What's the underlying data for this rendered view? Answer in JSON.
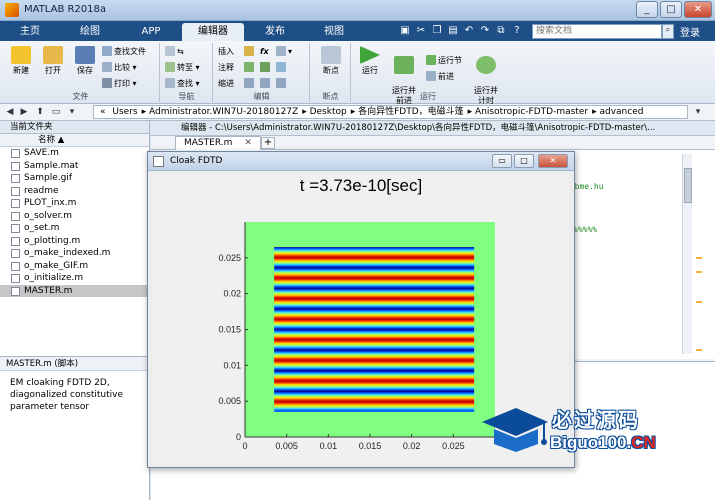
{
  "window": {
    "title": "MATLAB R2018a"
  },
  "tabs": [
    "主页",
    "绘图",
    "APP",
    "编辑器",
    "发布",
    "视图"
  ],
  "search": {
    "placeholder": "搜索文档"
  },
  "login": "登录",
  "ribbon": {
    "file": {
      "new": "新建",
      "open": "打开",
      "save": "保存",
      "find_files": "查找文件",
      "compare": "比较",
      "print": "打印",
      "label": "文件"
    },
    "navigate": {
      "goto": "转至",
      "find": "查找",
      "label": "导航"
    },
    "edit": {
      "insert": "插入",
      "comment": "注释",
      "indent": "缩进",
      "fx": "fx",
      "label": "编辑"
    },
    "breakpoints": {
      "breakpoints": "断点",
      "label": "断点"
    },
    "run": {
      "run": "运行",
      "run_advance": "运行并\n前进",
      "run_section": "运行节",
      "advance": "前进",
      "run_time": "运行并\n计时",
      "label": "运行"
    }
  },
  "address": {
    "prefix": "«",
    "segments": [
      "Users",
      "Administrator.WIN7U-20180127Z",
      "Desktop",
      "各向异性FDTD，电磁斗篷",
      "Anisotropic-FDTD-master",
      "advanced"
    ]
  },
  "filebrowser": {
    "header": "当前文件夹",
    "column": "名称 ▲",
    "files": [
      "SAVE.m",
      "Sample.mat",
      "Sample.gif",
      "readme",
      "PLOT_inx.m",
      "o_solver.m",
      "o_set.m",
      "o_plotting.m",
      "o_make_indexed.m",
      "o_make_GIF.m",
      "o_initialize.m",
      "MASTER.m"
    ],
    "selected": "MASTER.m"
  },
  "details": {
    "header": "MASTER.m  (脚本)",
    "description": "EM cloaking FDTD 2D, diagonalized constitutive parameter tensor"
  },
  "editor": {
    "header": "编辑器 - C:\\Users\\Administrator.WIN7U-20180127Z\\Desktop\\各向异性FDTD，电磁斗篷\\Anisotropic-FDTD-master\\...",
    "tab": "MASTER.m",
    "plus": "+",
    "fragment1": "h.bme.hu",
    "fragment2": "%%%%%"
  },
  "figure": {
    "window_title": "Cloak FDTD",
    "plot_title": "t =3.73e-10[sec]"
  },
  "chart_data": {
    "type": "heatmap",
    "title": "t =3.73e-10[sec]",
    "xlabel": "",
    "ylabel": "",
    "xlim": [
      0,
      0.03
    ],
    "ylim": [
      0,
      0.03
    ],
    "xticks": [
      0,
      0.005,
      0.01,
      0.015,
      0.02,
      0.025
    ],
    "yticks": [
      0,
      0.005,
      0.01,
      0.015,
      0.02,
      0.025
    ],
    "background_color": "#80ff80",
    "field_region": {
      "x": [
        0.0035,
        0.0275
      ],
      "y": [
        0.0035,
        0.0265
      ]
    },
    "pattern": "horizontal plane wave bands alternating red and blue",
    "band_count": 8
  },
  "watermark": {
    "title": "必过源码",
    "sub_prefix": "Biguo100.",
    "sub_suffix": "CN"
  },
  "colors": {
    "tab_bar": "#1e4f86",
    "accent": "#0b4c9a",
    "field_red": "#c80000",
    "field_blue": "#0000c0"
  }
}
